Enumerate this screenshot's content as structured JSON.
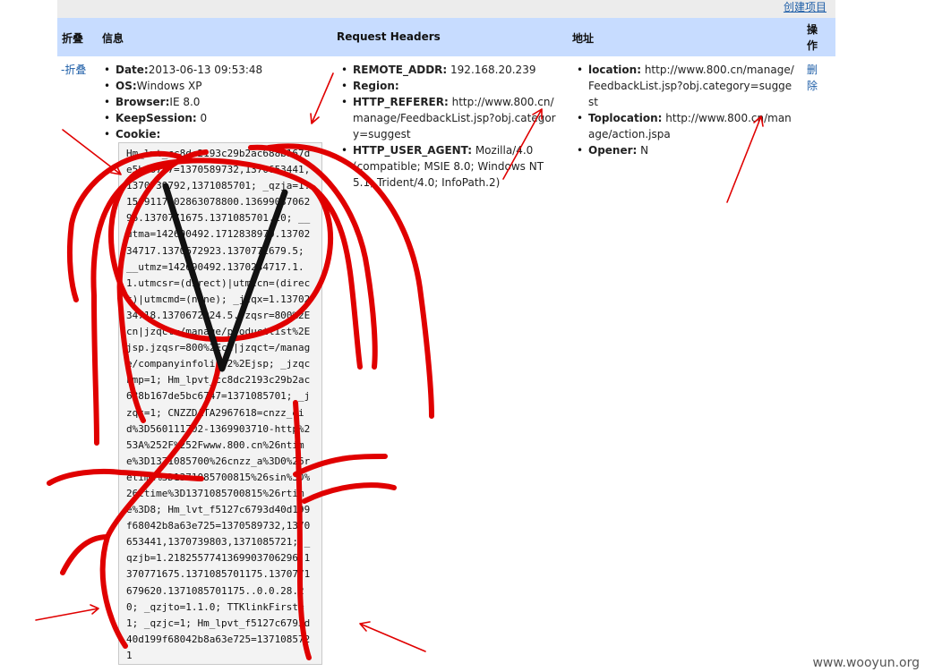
{
  "toolbar": {
    "create_link": "创建项目"
  },
  "table": {
    "headers": {
      "fold": "折叠",
      "info": "信息",
      "request_headers": "Request Headers",
      "address": "地址",
      "action": "操作"
    },
    "row": {
      "fold_link": "-折叠",
      "info_items": [
        {
          "key": "Date:",
          "value": "2013-06-13 09:53:48"
        },
        {
          "key": "OS:",
          "value": "Windows XP"
        },
        {
          "key": "Browser:",
          "value": "IE 8.0"
        },
        {
          "key": "KeepSession:",
          "value": " 0"
        },
        {
          "key": "Cookie:",
          "value": ""
        }
      ],
      "cookie_text": "Hm_lvt_cc8dc2193c29b2ac688b167de5bc6747=1370589732,1370653441,1370739792,1371085701; _qzja=1.1509117602863078800.1369903706296.1370771675.1371085701.20; __utma=142690492.1712838970.1370234717.1370672923.1370771679.5; __utmz=142690492.1370234717.1.1.utmcsr=(direct)|utmccn=(direct)|utmcmd=(none); _jzqx=1.1370234718.1370672924.5.jzqsr=800%2Ecn|jzqct=/manage/productlist%2Ejsp.jzqsr=800%2Ecn|jzqct=/manage/companyinfolist2%2Ejsp; _jzqckmp=1; Hm_lpvt_cc8dc2193c29b2ac688b167de5bc6747=1371085701; _jzqc=1; CNZZDATA2967618=cnzz_eid%3D560111702-1369903710-http%253A%252F%252Fwww.800.cn%26ntime%3D1371085700%26cnzz_a%3D0%26retime%3D1371085700815%26sin%3D%26ltime%3D1371085700815%26rtime%3D8; Hm_lvt_f5127c6793d40d199f68042b8a63e725=1370589732,1370653441,1370739803,1371085721; _qzjb=1.2182557741369903706296.1370771675.1371085701175.1370771679620.1371085701175..0.0.28.20; _qzjto=1.1.0; TTKlinkFirst=1; _qzjc=1; Hm_lpvt_f5127c6793d40d199f68042b8a63e725=1371085721",
      "request_items": [
        {
          "key": "REMOTE_ADDR:",
          "value": " 192.168.20.239"
        },
        {
          "key": "Region:",
          "value": ""
        },
        {
          "key": "HTTP_REFERER:",
          "value": " http://www.800.cn/manage/FeedbackList.jsp?obj.category=suggest"
        },
        {
          "key": "HTTP_USER_AGENT:",
          "value": " Mozilla/4.0 (compatible; MSIE 8.0; Windows NT 5.1; Trident/4.0; InfoPath.2)"
        }
      ],
      "address_items": [
        {
          "key": "location:",
          "value": " http://www.800.cn/manage/FeedbackList.jsp?obj.category=suggest"
        },
        {
          "key": "Toplocation:",
          "value": " http://www.800.cn/manage/action.jspa"
        },
        {
          "key": "Opener:",
          "value": " N"
        }
      ],
      "delete_link": "删除"
    }
  },
  "watermark": "www.wooyun.org",
  "colors": {
    "header_bg": "#c7dcff",
    "link": "#1f5fa8",
    "annotation_red": "#e00000"
  }
}
